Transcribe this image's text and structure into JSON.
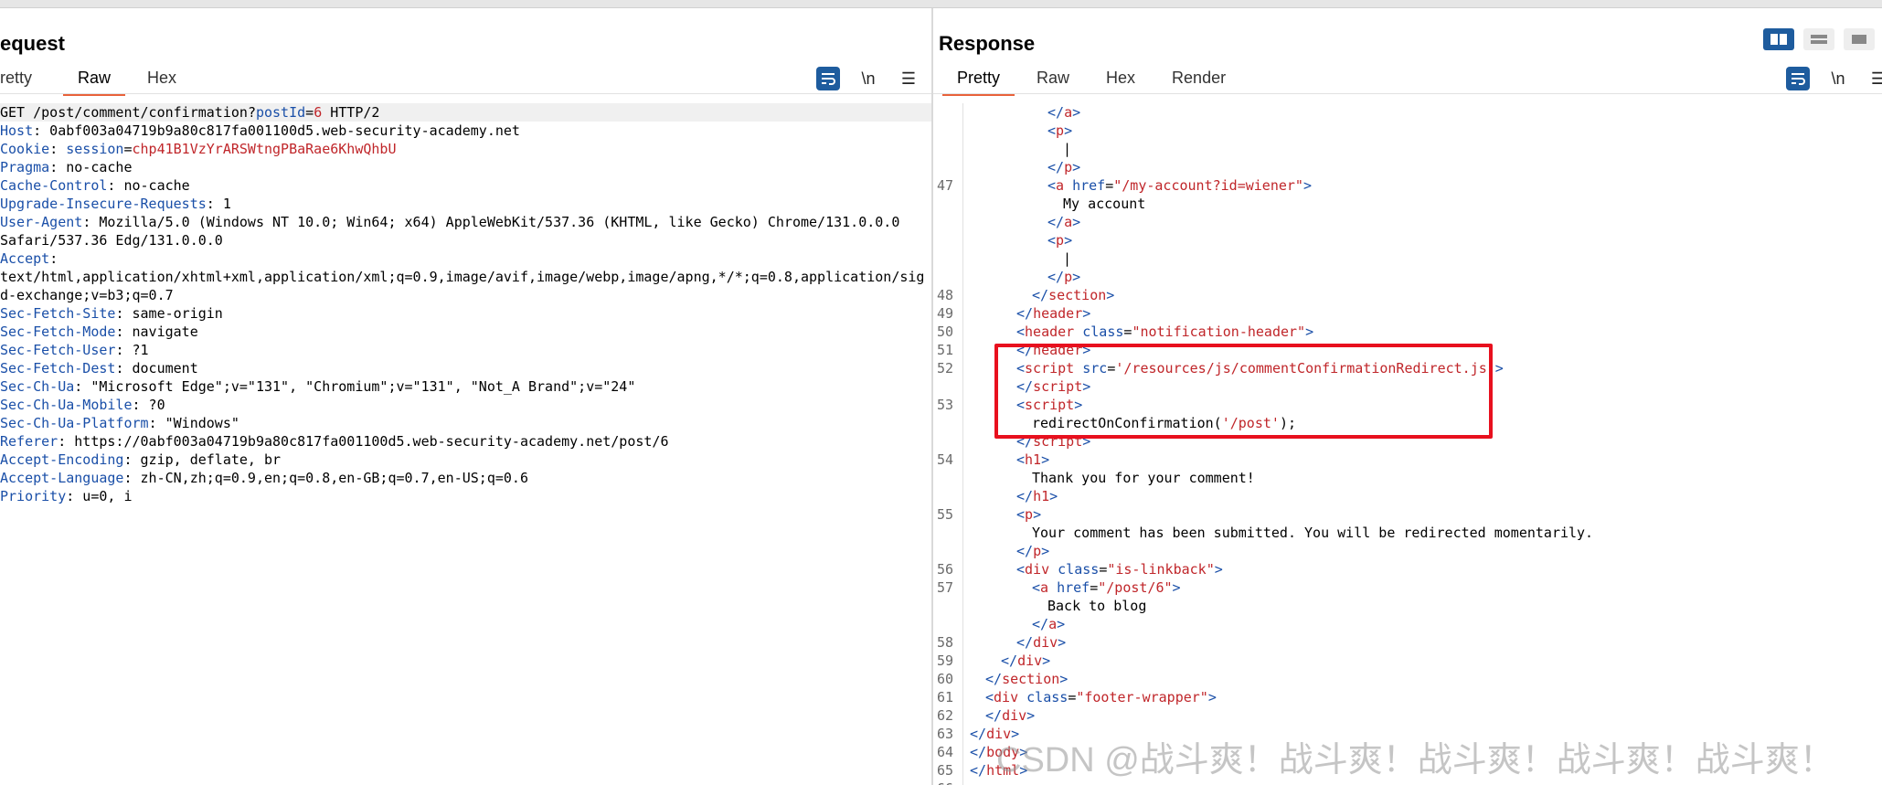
{
  "request": {
    "title": "equest",
    "tabs": [
      "retty",
      "Raw",
      "Hex"
    ],
    "active_tab": "Raw",
    "tools": {
      "wrap": "≡",
      "newline": "\\n",
      "menu": "☰"
    },
    "lines": [
      [
        {
          "t": "GET /post/comment/confirmation"
        },
        {
          "t": "?"
        },
        {
          "t": "postId",
          "c": "k"
        },
        {
          "t": "="
        },
        {
          "t": "6",
          "c": "v"
        },
        {
          "t": " HTTP/2"
        }
      ],
      [
        {
          "t": "Host",
          "c": "k"
        },
        {
          "t": ": 0abf003a04719b9a80c817fa001100d5.web-security-academy.net"
        }
      ],
      [
        {
          "t": "Cookie",
          "c": "k"
        },
        {
          "t": ": "
        },
        {
          "t": "session",
          "c": "k"
        },
        {
          "t": "="
        },
        {
          "t": "chp41B1VzYrARSWtngPBaRae6KhwQhbU",
          "c": "v"
        }
      ],
      [
        {
          "t": "Pragma",
          "c": "k"
        },
        {
          "t": ": no-cache"
        }
      ],
      [
        {
          "t": "Cache-Control",
          "c": "k"
        },
        {
          "t": ": no-cache"
        }
      ],
      [
        {
          "t": "Upgrade-Insecure-Requests",
          "c": "k"
        },
        {
          "t": ": 1"
        }
      ],
      [
        {
          "t": "User-Agent",
          "c": "k"
        },
        {
          "t": ": Mozilla/5.0 (Windows NT 10.0; Win64; x64) AppleWebKit/537.36 (KHTML, like Gecko) Chrome/131.0.0.0"
        }
      ],
      [
        {
          "t": "Safari/537.36 Edg/131.0.0.0"
        }
      ],
      [
        {
          "t": "Accept",
          "c": "k"
        },
        {
          "t": ":"
        }
      ],
      [
        {
          "t": "text/html,application/xhtml+xml,application/xml;q=0.9,image/avif,image/webp,image/apng,*/*;q=0.8,application/sig"
        }
      ],
      [
        {
          "t": "d-exchange;v=b3;q=0.7"
        }
      ],
      [
        {
          "t": "Sec-Fetch-Site",
          "c": "k"
        },
        {
          "t": ": same-origin"
        }
      ],
      [
        {
          "t": "Sec-Fetch-Mode",
          "c": "k"
        },
        {
          "t": ": navigate"
        }
      ],
      [
        {
          "t": "Sec-Fetch-User",
          "c": "k"
        },
        {
          "t": ": ?1"
        }
      ],
      [
        {
          "t": "Sec-Fetch-Dest",
          "c": "k"
        },
        {
          "t": ": document"
        }
      ],
      [
        {
          "t": "Sec-Ch-Ua",
          "c": "k"
        },
        {
          "t": ": \"Microsoft Edge\";v=\"131\", \"Chromium\";v=\"131\", \"Not_A Brand\";v=\"24\""
        }
      ],
      [
        {
          "t": "Sec-Ch-Ua-Mobile",
          "c": "k"
        },
        {
          "t": ": ?0"
        }
      ],
      [
        {
          "t": "Sec-Ch-Ua-Platform",
          "c": "k"
        },
        {
          "t": ": \"Windows\""
        }
      ],
      [
        {
          "t": "Referer",
          "c": "k"
        },
        {
          "t": ": https://0abf003a04719b9a80c817fa001100d5.web-security-academy.net/post/6"
        }
      ],
      [
        {
          "t": "Accept-Encoding",
          "c": "k"
        },
        {
          "t": ": gzip, deflate, br"
        }
      ],
      [
        {
          "t": "Accept-Language",
          "c": "k"
        },
        {
          "t": ": zh-CN,zh;q=0.9,en;q=0.8,en-GB;q=0.7,en-US;q=0.6"
        }
      ],
      [
        {
          "t": "Priority",
          "c": "k"
        },
        {
          "t": ": u=0, i"
        }
      ]
    ]
  },
  "response": {
    "title": "Response",
    "tabs": [
      "Pretty",
      "Raw",
      "Hex",
      "Render"
    ],
    "active_tab": "Pretty",
    "tools": {
      "wrap": "≡",
      "newline": "\\n",
      "menu": "☰"
    },
    "lines": [
      {
        "n": "",
        "ind": 5,
        "s": [
          {
            "t": "</",
            "c": "k"
          },
          {
            "t": "a",
            "c": "v"
          },
          {
            "t": ">",
            "c": "k"
          }
        ]
      },
      {
        "n": "",
        "ind": 5,
        "s": [
          {
            "t": "<",
            "c": "k"
          },
          {
            "t": "p",
            "c": "v"
          },
          {
            "t": ">",
            "c": "k"
          }
        ]
      },
      {
        "n": "",
        "ind": 6,
        "s": [
          {
            "t": "|"
          }
        ]
      },
      {
        "n": "",
        "ind": 5,
        "s": [
          {
            "t": "</",
            "c": "k"
          },
          {
            "t": "p",
            "c": "v"
          },
          {
            "t": ">",
            "c": "k"
          }
        ]
      },
      {
        "n": "47",
        "ind": 5,
        "s": [
          {
            "t": "<",
            "c": "k"
          },
          {
            "t": "a",
            "c": "v"
          },
          {
            "t": " href",
            "c": "k"
          },
          {
            "t": "="
          },
          {
            "t": "\"/my-account?id=wiener\"",
            "c": "v"
          },
          {
            "t": ">",
            "c": "k"
          }
        ]
      },
      {
        "n": "",
        "ind": 6,
        "s": [
          {
            "t": "My account"
          }
        ]
      },
      {
        "n": "",
        "ind": 5,
        "s": [
          {
            "t": "</",
            "c": "k"
          },
          {
            "t": "a",
            "c": "v"
          },
          {
            "t": ">",
            "c": "k"
          }
        ]
      },
      {
        "n": "",
        "ind": 5,
        "s": [
          {
            "t": "<",
            "c": "k"
          },
          {
            "t": "p",
            "c": "v"
          },
          {
            "t": ">",
            "c": "k"
          }
        ]
      },
      {
        "n": "",
        "ind": 6,
        "s": [
          {
            "t": "|"
          }
        ]
      },
      {
        "n": "",
        "ind": 5,
        "s": [
          {
            "t": "</",
            "c": "k"
          },
          {
            "t": "p",
            "c": "v"
          },
          {
            "t": ">",
            "c": "k"
          }
        ]
      },
      {
        "n": "48",
        "ind": 4,
        "s": [
          {
            "t": "</",
            "c": "k"
          },
          {
            "t": "section",
            "c": "v"
          },
          {
            "t": ">",
            "c": "k"
          }
        ]
      },
      {
        "n": "49",
        "ind": 3,
        "s": [
          {
            "t": "</",
            "c": "k"
          },
          {
            "t": "header",
            "c": "v"
          },
          {
            "t": ">",
            "c": "k"
          }
        ]
      },
      {
        "n": "50",
        "ind": 3,
        "s": [
          {
            "t": "<",
            "c": "k"
          },
          {
            "t": "header",
            "c": "v"
          },
          {
            "t": " class",
            "c": "k"
          },
          {
            "t": "="
          },
          {
            "t": "\"notification-header\"",
            "c": "v"
          },
          {
            "t": ">",
            "c": "k"
          }
        ]
      },
      {
        "n": "51",
        "ind": 3,
        "s": [
          {
            "t": "</",
            "c": "k"
          },
          {
            "t": "header",
            "c": "v"
          },
          {
            "t": ">",
            "c": "k"
          }
        ]
      },
      {
        "n": "52",
        "ind": 3,
        "s": [
          {
            "t": "<",
            "c": "k"
          },
          {
            "t": "script",
            "c": "v"
          },
          {
            "t": " src",
            "c": "k"
          },
          {
            "t": "="
          },
          {
            "t": "'/resources/js/commentConfirmationRedirect.js'",
            "c": "v"
          },
          {
            "t": ">",
            "c": "k"
          }
        ]
      },
      {
        "n": "",
        "ind": 3,
        "s": [
          {
            "t": "</",
            "c": "k"
          },
          {
            "t": "script",
            "c": "v"
          },
          {
            "t": ">",
            "c": "k"
          }
        ]
      },
      {
        "n": "53",
        "ind": 3,
        "s": [
          {
            "t": "<",
            "c": "k"
          },
          {
            "t": "script",
            "c": "v"
          },
          {
            "t": ">",
            "c": "k"
          }
        ]
      },
      {
        "n": "",
        "ind": 4,
        "s": [
          {
            "t": "redirectOnConfirmation("
          },
          {
            "t": "'/post'",
            "c": "v"
          },
          {
            "t": ");"
          }
        ]
      },
      {
        "n": "",
        "ind": 3,
        "s": [
          {
            "t": "</",
            "c": "k"
          },
          {
            "t": "script",
            "c": "v"
          },
          {
            "t": ">",
            "c": "k"
          }
        ]
      },
      {
        "n": "54",
        "ind": 3,
        "s": [
          {
            "t": "<",
            "c": "k"
          },
          {
            "t": "h1",
            "c": "v"
          },
          {
            "t": ">",
            "c": "k"
          }
        ]
      },
      {
        "n": "",
        "ind": 4,
        "s": [
          {
            "t": "Thank you for your comment!"
          }
        ]
      },
      {
        "n": "",
        "ind": 3,
        "s": [
          {
            "t": "</",
            "c": "k"
          },
          {
            "t": "h1",
            "c": "v"
          },
          {
            "t": ">",
            "c": "k"
          }
        ]
      },
      {
        "n": "55",
        "ind": 3,
        "s": [
          {
            "t": "<",
            "c": "k"
          },
          {
            "t": "p",
            "c": "v"
          },
          {
            "t": ">",
            "c": "k"
          }
        ]
      },
      {
        "n": "",
        "ind": 4,
        "s": [
          {
            "t": "Your comment has been submitted. You will be redirected momentarily."
          }
        ]
      },
      {
        "n": "",
        "ind": 3,
        "s": [
          {
            "t": "</",
            "c": "k"
          },
          {
            "t": "p",
            "c": "v"
          },
          {
            "t": ">",
            "c": "k"
          }
        ]
      },
      {
        "n": "56",
        "ind": 3,
        "s": [
          {
            "t": "<",
            "c": "k"
          },
          {
            "t": "div",
            "c": "v"
          },
          {
            "t": " class",
            "c": "k"
          },
          {
            "t": "="
          },
          {
            "t": "\"is-linkback\"",
            "c": "v"
          },
          {
            "t": ">",
            "c": "k"
          }
        ]
      },
      {
        "n": "57",
        "ind": 4,
        "s": [
          {
            "t": "<",
            "c": "k"
          },
          {
            "t": "a",
            "c": "v"
          },
          {
            "t": " href",
            "c": "k"
          },
          {
            "t": "="
          },
          {
            "t": "\"/post/6\"",
            "c": "v"
          },
          {
            "t": ">",
            "c": "k"
          }
        ]
      },
      {
        "n": "",
        "ind": 5,
        "s": [
          {
            "t": "Back to blog"
          }
        ]
      },
      {
        "n": "",
        "ind": 4,
        "s": [
          {
            "t": "</",
            "c": "k"
          },
          {
            "t": "a",
            "c": "v"
          },
          {
            "t": ">",
            "c": "k"
          }
        ]
      },
      {
        "n": "58",
        "ind": 3,
        "s": [
          {
            "t": "</",
            "c": "k"
          },
          {
            "t": "div",
            "c": "v"
          },
          {
            "t": ">",
            "c": "k"
          }
        ]
      },
      {
        "n": "59",
        "ind": 2,
        "s": [
          {
            "t": "</",
            "c": "k"
          },
          {
            "t": "div",
            "c": "v"
          },
          {
            "t": ">",
            "c": "k"
          }
        ]
      },
      {
        "n": "60",
        "ind": 1,
        "s": [
          {
            "t": "</",
            "c": "k"
          },
          {
            "t": "section",
            "c": "v"
          },
          {
            "t": ">",
            "c": "k"
          }
        ]
      },
      {
        "n": "61",
        "ind": 1,
        "s": [
          {
            "t": "<",
            "c": "k"
          },
          {
            "t": "div",
            "c": "v"
          },
          {
            "t": " class",
            "c": "k"
          },
          {
            "t": "="
          },
          {
            "t": "\"footer-wrapper\"",
            "c": "v"
          },
          {
            "t": ">",
            "c": "k"
          }
        ]
      },
      {
        "n": "62",
        "ind": 1,
        "s": [
          {
            "t": "</",
            "c": "k"
          },
          {
            "t": "div",
            "c": "v"
          },
          {
            "t": ">",
            "c": "k"
          }
        ]
      },
      {
        "n": "63",
        "ind": 0,
        "s": [
          {
            "t": "</",
            "c": "k"
          },
          {
            "t": "div",
            "c": "v"
          },
          {
            "t": ">",
            "c": "k"
          }
        ]
      },
      {
        "n": "64",
        "ind": 0,
        "s": [
          {
            "t": "</",
            "c": "k"
          },
          {
            "t": "body",
            "c": "v"
          },
          {
            "t": ">",
            "c": "k"
          }
        ]
      },
      {
        "n": "65",
        "ind": 0,
        "s": [
          {
            "t": "</",
            "c": "k"
          },
          {
            "t": "html",
            "c": "v"
          },
          {
            "t": ">",
            "c": "k"
          }
        ]
      },
      {
        "n": "66",
        "ind": 0,
        "s": []
      }
    ]
  },
  "watermark": "CSDN @战斗爽！战斗爽！战斗爽！战斗爽！战斗爽！",
  "colors": {
    "accent": "#e8623a",
    "highlight_box": "#e8101e",
    "tool_blue": "#1e5c9e",
    "keyword": "#1a4fa8",
    "value": "#c0262a"
  }
}
